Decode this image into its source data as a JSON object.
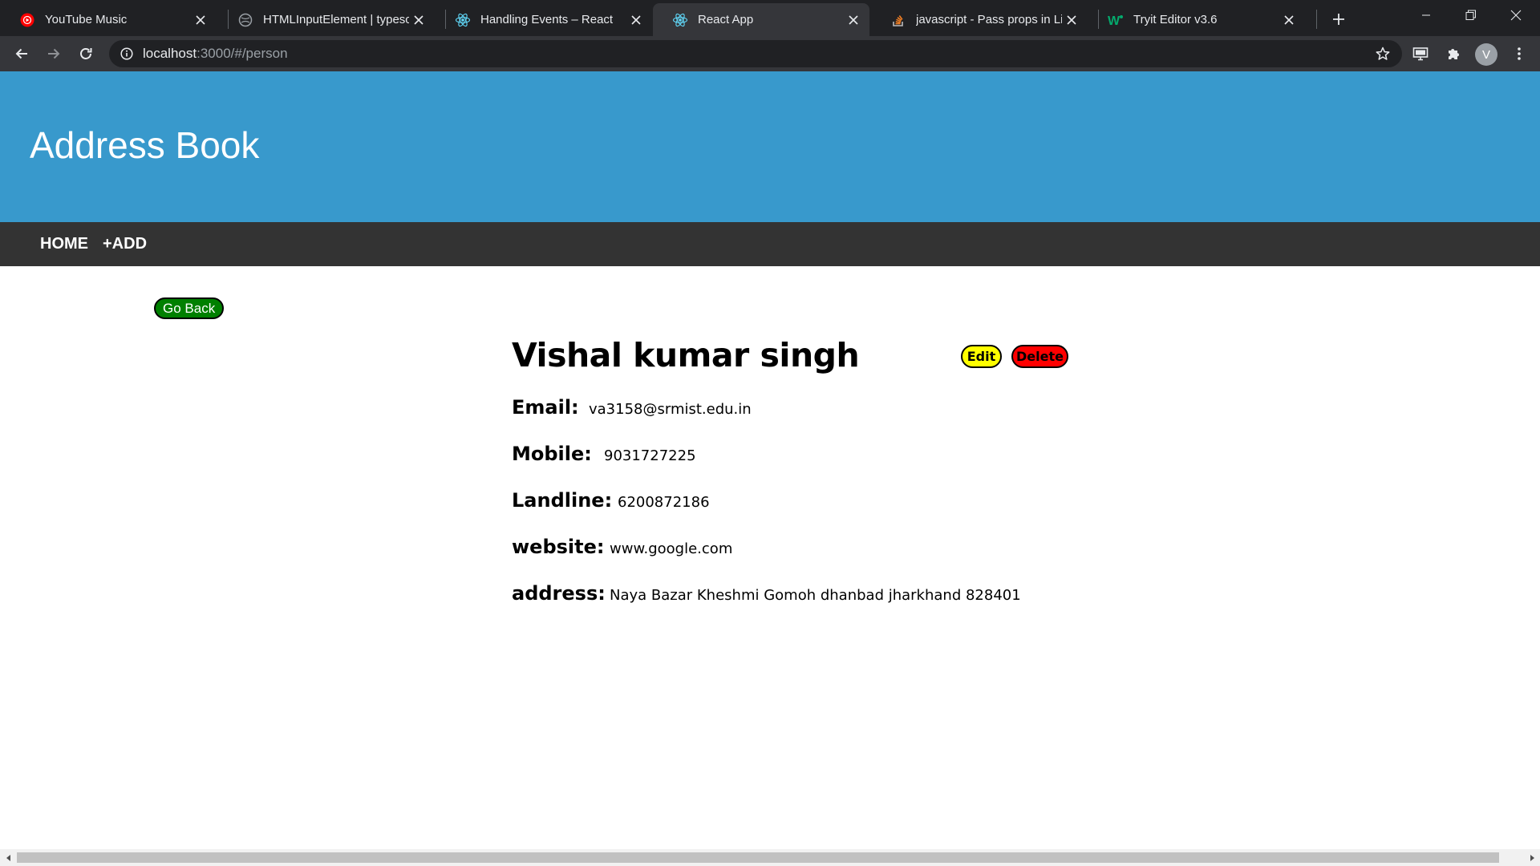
{
  "browser": {
    "tabs": [
      {
        "title": "YouTube Music",
        "icon": "youtube-music-icon",
        "active": false
      },
      {
        "title": "HTMLInputElement | typescript",
        "icon": "globe-icon",
        "active": false
      },
      {
        "title": "Handling Events – React",
        "icon": "react-icon",
        "active": false
      },
      {
        "title": "React App",
        "icon": "react-icon",
        "active": true
      },
      {
        "title": "javascript - Pass props in Link",
        "icon": "stackoverflow-icon",
        "active": false
      },
      {
        "title": "Tryit Editor v3.6",
        "icon": "w3schools-icon",
        "active": false
      }
    ],
    "url_host": "localhost",
    "url_path": ":3000/#/person",
    "profile_initial": "V",
    "colors": {
      "tabstrip": "#202124",
      "toolbar": "#35363a"
    }
  },
  "app": {
    "title": "Address Book",
    "nav": {
      "home": "HOME",
      "add": "+ADD"
    },
    "colors": {
      "header": "#3899cc",
      "nav": "#333333"
    }
  },
  "person": {
    "go_back_label": "Go Back",
    "name": "Vishal kumar singh",
    "edit_label": "Edit",
    "delete_label": "Delete",
    "fields": [
      {
        "label": "Email:",
        "value": "va3158@srmist.edu.in"
      },
      {
        "label": "Mobile:",
        "value": "9031727225"
      },
      {
        "label": "Landline:",
        "value": "6200872186"
      },
      {
        "label": "website:",
        "value": "www.google.com"
      },
      {
        "label": "address:",
        "value": "Naya Bazar Kheshmi Gomoh dhanbad jharkhand 828401"
      }
    ],
    "colors": {
      "go_back": "#008000",
      "edit": "#ffff00",
      "delete": "#ff0000"
    }
  }
}
